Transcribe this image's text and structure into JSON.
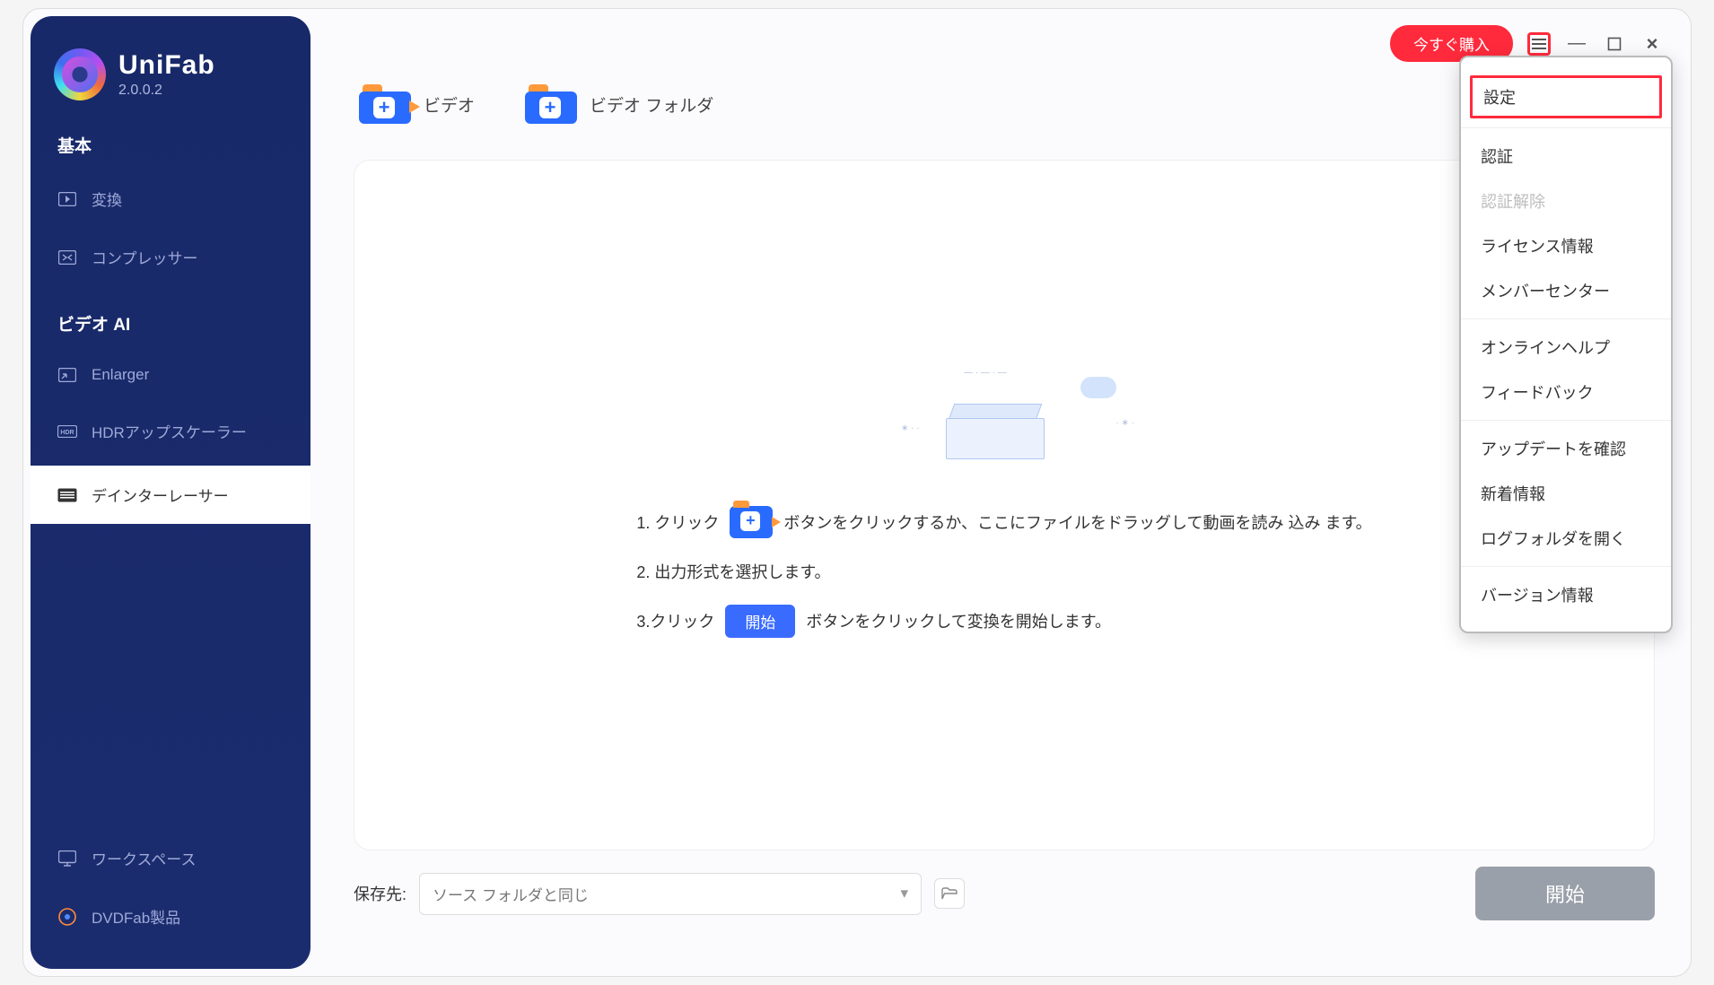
{
  "app": {
    "name": "UniFab",
    "version": "2.0.0.2"
  },
  "titlebar": {
    "buy_now": "今すぐ購入"
  },
  "sidebar": {
    "section_basic": "基本",
    "section_ai": "ビデオ AI",
    "items": {
      "convert": "変換",
      "compressor": "コンプレッサー",
      "enlarger": "Enlarger",
      "hdr": "HDRアップスケーラー",
      "deinterlacer": "デインターレーサー",
      "workspace": "ワークスペース",
      "dvdfab": "DVDFab製品"
    }
  },
  "topbar": {
    "video": "ビデオ",
    "video_folder": "ビデオ フォルダ"
  },
  "steps": {
    "s1_pre": "1. クリック",
    "s1_post": "ボタンをクリックするか、ここにファイルをドラッグして動画を読み 込み ます。",
    "s2": "2. 出力形式を選択します。",
    "s3_pre": "3.クリック",
    "s3_btn": "開始",
    "s3_post": "ボタンをクリックして変換を開始します。"
  },
  "bottom": {
    "save_to": "保存先:",
    "save_value": "ソース フォルダと同じ",
    "start": "開始"
  },
  "menu": {
    "settings": "設定",
    "auth": "認証",
    "deauth": "認証解除",
    "license": "ライセンス情報",
    "member": "メンバーセンター",
    "help": "オンラインヘルプ",
    "feedback": "フィードバック",
    "update": "アップデートを確認",
    "news": "新着情報",
    "log": "ログフォルダを開く",
    "about": "バージョン情報"
  }
}
